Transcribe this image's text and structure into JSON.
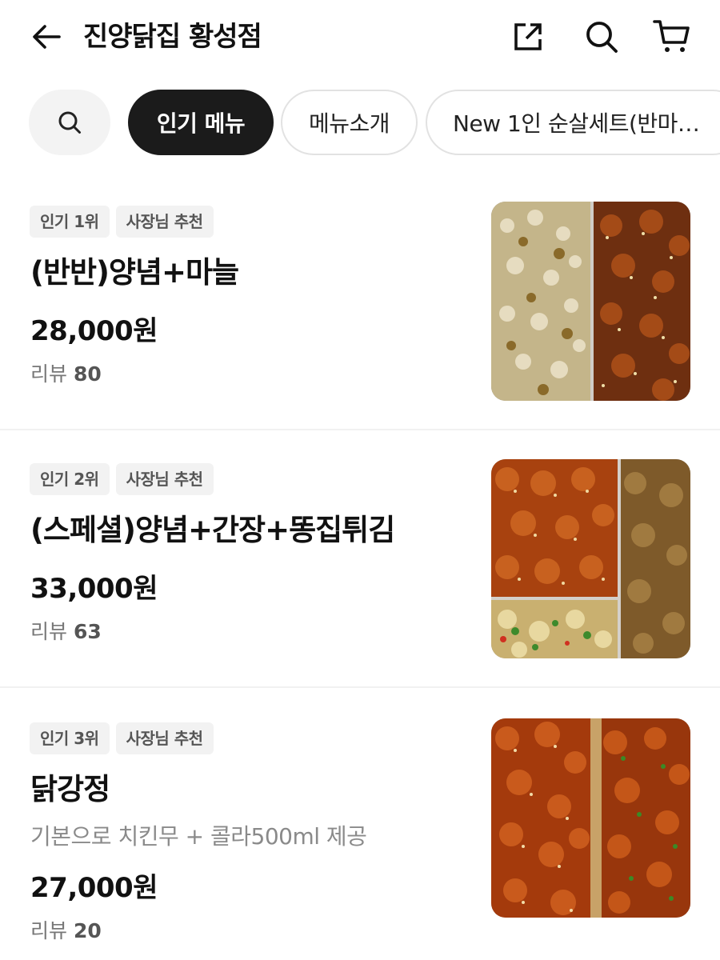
{
  "header": {
    "title": "진양닭집 황성점"
  },
  "chips": {
    "popular": "인기 메뉴",
    "intro": "메뉴소개",
    "set": "New 1인 순살세트(반마…"
  },
  "items": [
    {
      "badge_rank": "인기 1위",
      "badge_owner": "사장님 추천",
      "name": "(반반)양념+마늘",
      "price": "28,000원",
      "review_label": "리뷰",
      "review_count": "80"
    },
    {
      "badge_rank": "인기 2위",
      "badge_owner": "사장님 추천",
      "name": "(스페셜)양념+간장+똥집튀김",
      "price": "33,000원",
      "review_label": "리뷰",
      "review_count": "63"
    },
    {
      "badge_rank": "인기 3위",
      "badge_owner": "사장님 추천",
      "name": "닭강정",
      "description": "기본으로 치킨무 + 콜라500ml 제공",
      "price": "27,000원",
      "review_label": "리뷰",
      "review_count": "20"
    }
  ]
}
